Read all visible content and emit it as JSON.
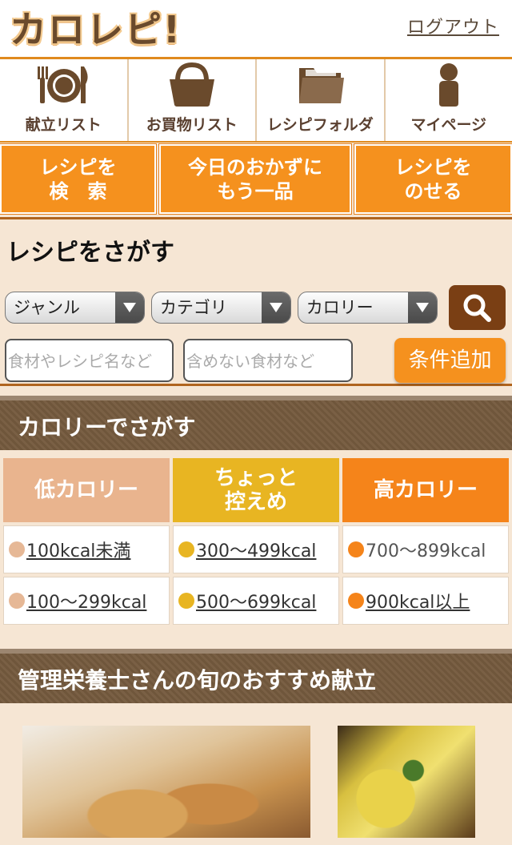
{
  "header": {
    "logo_text": "カロレピ!",
    "logout_label": "ログアウト"
  },
  "iconnav": [
    {
      "label": "献立リスト",
      "icon": "plate-cutlery-icon"
    },
    {
      "label": "お買物リスト",
      "icon": "basket-icon"
    },
    {
      "label": "レシピフォルダ",
      "icon": "folder-icon"
    },
    {
      "label": "マイページ",
      "icon": "person-icon"
    }
  ],
  "bigbuttons": [
    {
      "label": "レシピを\n検　索"
    },
    {
      "label": "今日のおかずに\nもう一品"
    },
    {
      "label": "レシピを\nのせる"
    }
  ],
  "search": {
    "title": "レシピをさがす",
    "selects": [
      {
        "value": "ジャンル"
      },
      {
        "value": "カテゴリ"
      },
      {
        "value": "カロリー"
      }
    ],
    "ingredient_placeholder": "食材やレシピ名など",
    "exclude_placeholder": "含めない食材など",
    "add_condition_label": "条件追加"
  },
  "calorie_section": {
    "title": "カロリーでさがす",
    "columns": [
      {
        "label": "低カロリー",
        "color": "#e9b48e",
        "dot": "#e6b896",
        "items": [
          {
            "text": "100kcal未満",
            "link": true
          },
          {
            "text": "100〜299kcal",
            "link": true
          }
        ]
      },
      {
        "label": "ちょっと\n控えめ",
        "color": "#e8b522",
        "dot": "#e8b522",
        "items": [
          {
            "text": "300〜499kcal",
            "link": true
          },
          {
            "text": "500〜699kcal",
            "link": true
          }
        ]
      },
      {
        "label": "高カロリー",
        "color": "#f5841a",
        "dot": "#f5841a",
        "items": [
          {
            "text": "700〜899kcal",
            "link": false
          },
          {
            "text": "900kcal以上",
            "link": true
          }
        ]
      }
    ]
  },
  "recommend_section": {
    "title": "管理栄養士さんの旬のおすすめ献立"
  }
}
